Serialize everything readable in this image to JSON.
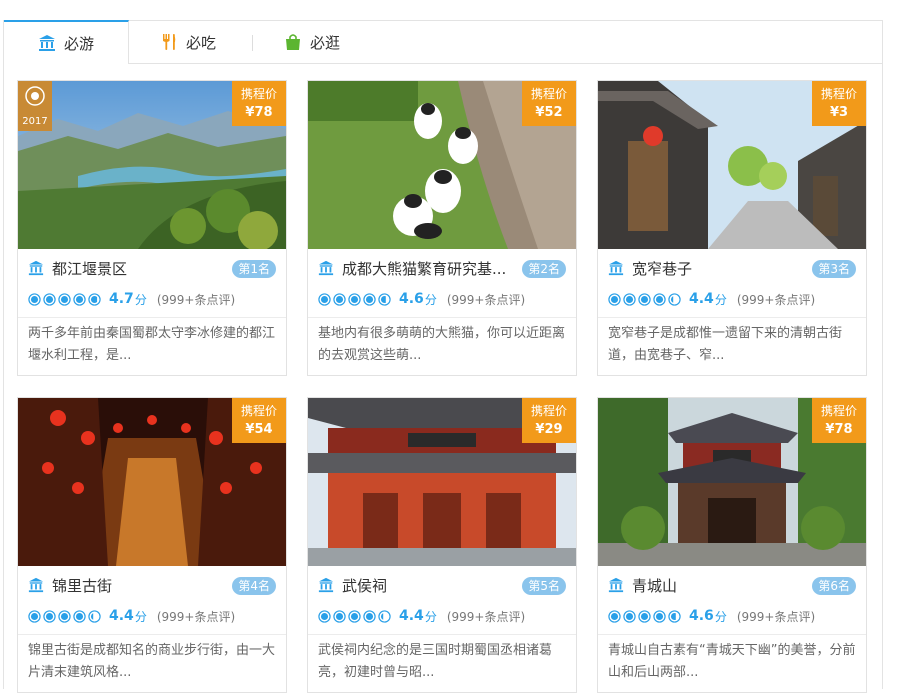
{
  "tabs": [
    {
      "label": "必游",
      "icon": "museum-icon"
    },
    {
      "label": "必吃",
      "icon": "fork-knife-icon"
    },
    {
      "label": "必逛",
      "icon": "shopping-bag-icon"
    }
  ],
  "badge_year": "2017",
  "price_label": "携程价",
  "score_unit": "分",
  "colors": {
    "accent": "#2aa0e8",
    "price": "#f29a1a",
    "rank": "#8ac4ec"
  },
  "cards": [
    {
      "name": "都江堰景区",
      "rank": "第1名",
      "score": "4.7",
      "rating": 4.7,
      "reviews": "(999+条点评)",
      "price": "¥78",
      "desc": "两千多年前由秦国蜀郡太守李冰修建的都江堰水利工程，是..."
    },
    {
      "name": "成都大熊猫繁育研究基...",
      "rank": "第2名",
      "score": "4.6",
      "rating": 4.6,
      "reviews": "(999+条点评)",
      "price": "¥52",
      "desc": "基地内有很多萌萌的大熊猫，你可以近距离的去观赏这些萌..."
    },
    {
      "name": "宽窄巷子",
      "rank": "第3名",
      "score": "4.4",
      "rating": 4.4,
      "reviews": "(999+条点评)",
      "price": "¥3",
      "desc": "宽窄巷子是成都惟一遗留下来的清朝古街道，由宽巷子、窄..."
    },
    {
      "name": "锦里古街",
      "rank": "第4名",
      "score": "4.4",
      "rating": 4.4,
      "reviews": "(999+条点评)",
      "price": "¥54",
      "desc": "锦里古街是成都知名的商业步行街，由一大片清末建筑风格..."
    },
    {
      "name": "武侯祠",
      "rank": "第5名",
      "score": "4.4",
      "rating": 4.4,
      "reviews": "(999+条点评)",
      "price": "¥29",
      "desc": "武侯祠内纪念的是三国时期蜀国丞相诸葛亮，初建时曾与昭..."
    },
    {
      "name": "青城山",
      "rank": "第6名",
      "score": "4.6",
      "rating": 4.6,
      "reviews": "(999+条点评)",
      "price": "¥78",
      "desc": "青城山自古素有“青城天下幽”的美誉，分前山和后山两部..."
    }
  ]
}
